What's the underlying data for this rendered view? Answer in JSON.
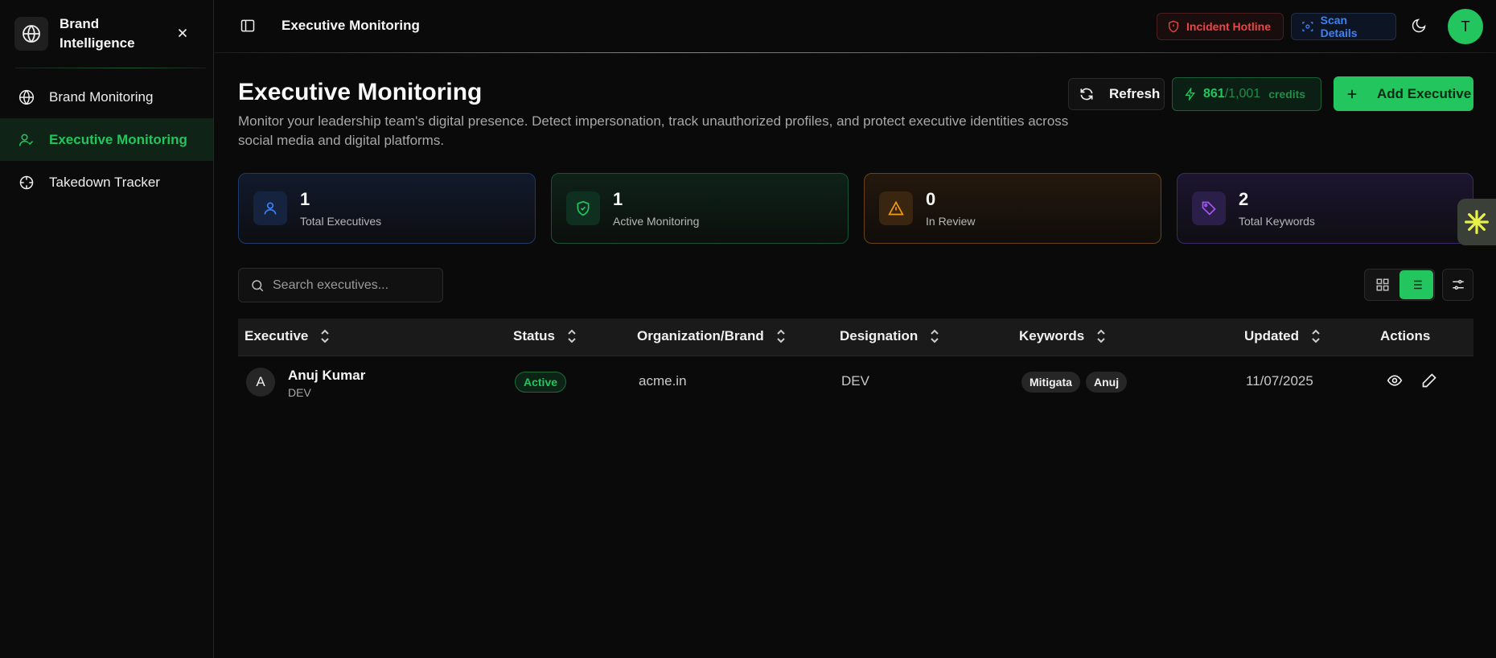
{
  "sidebar": {
    "brand_name": "Brand Intelligence",
    "items": [
      {
        "label": "Brand Monitoring",
        "icon": "globe-icon",
        "active": false
      },
      {
        "label": "Executive Monitoring",
        "icon": "user-check-icon",
        "active": true
      },
      {
        "label": "Takedown Tracker",
        "icon": "crosshair-icon",
        "active": false
      }
    ]
  },
  "header": {
    "title": "Executive Monitoring",
    "incident_label": "Incident Hotline",
    "scan_label": "Scan Details",
    "avatar_initial": "T"
  },
  "main": {
    "title": "Executive Monitoring",
    "description": "Monitor your leadership team's digital presence. Detect impersonation, track unauthorized profiles, and protect executive identities across social media and digital platforms.",
    "refresh_label": "Refresh",
    "credits": {
      "used": "861",
      "total": "/1,001",
      "label": "credits"
    },
    "add_label": "Add Executive"
  },
  "stats": [
    {
      "value": "1",
      "label": "Total Executives",
      "color": "#3b82f6"
    },
    {
      "value": "1",
      "label": "Active Monitoring",
      "color": "#22c55e"
    },
    {
      "value": "0",
      "label": "In Review",
      "color": "#f59e0b"
    },
    {
      "value": "2",
      "label": "Total Keywords",
      "color": "#a855f7"
    }
  ],
  "search": {
    "placeholder": "Search executives..."
  },
  "table": {
    "columns": [
      "Executive",
      "Status",
      "Organization/Brand",
      "Designation",
      "Keywords",
      "Updated",
      "Actions"
    ],
    "rows": [
      {
        "initial": "A",
        "name": "Anuj Kumar",
        "sub": "DEV",
        "status": "Active",
        "organization": "acme.in",
        "designation": "DEV",
        "keywords": [
          "Mitigata",
          "Anuj"
        ],
        "updated": "11/07/2025"
      }
    ]
  },
  "colors": {
    "accent": "#22c55e",
    "danger": "#ef4444",
    "info": "#3b82f6",
    "warning": "#f59e0b",
    "purple": "#a855f7"
  }
}
